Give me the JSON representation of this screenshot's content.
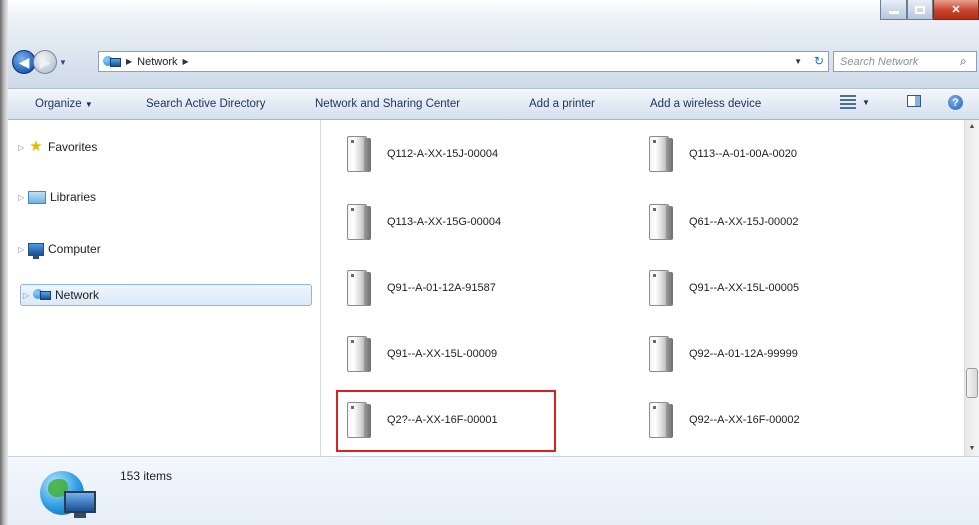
{
  "window": {
    "buttons": [
      "minimize",
      "maximize",
      "close"
    ]
  },
  "address": {
    "crumbs": [
      "Network"
    ]
  },
  "search": {
    "placeholder": "Search Network"
  },
  "toolbar": {
    "organize": "Organize",
    "search_ad": "Search Active Directory",
    "network_sharing": "Network and Sharing Center",
    "add_printer": "Add a printer",
    "add_wireless": "Add a wireless device"
  },
  "nav": {
    "items": [
      {
        "label": "Favorites",
        "icon": "star-icon"
      },
      {
        "label": "Libraries",
        "icon": "libraries-icon"
      },
      {
        "label": "Computer",
        "icon": "computer-icon"
      },
      {
        "label": "Network",
        "icon": "network-icon",
        "selected": true
      }
    ]
  },
  "content": {
    "items": [
      {
        "label": "Q112-A-XX-15J-00004"
      },
      {
        "label": "Q113--A-01-00A-0020"
      },
      {
        "label": "Q113-A-XX-15G-00004"
      },
      {
        "label": "Q61--A-XX-15J-00002"
      },
      {
        "label": "Q91--A-01-12A-91587"
      },
      {
        "label": "Q91--A-XX-15L-00005"
      },
      {
        "label": "Q91--A-XX-15L-00009"
      },
      {
        "label": "Q92--A-01-12A-99999"
      },
      {
        "label": "Q2?--A-XX-16F-00001",
        "highlighted": true
      },
      {
        "label": "Q92--A-XX-16F-00002"
      }
    ]
  },
  "status": {
    "count_text": "153 items"
  },
  "colors": {
    "highlight": "#dd1f1f",
    "selection_border": "#8eb5e4"
  }
}
